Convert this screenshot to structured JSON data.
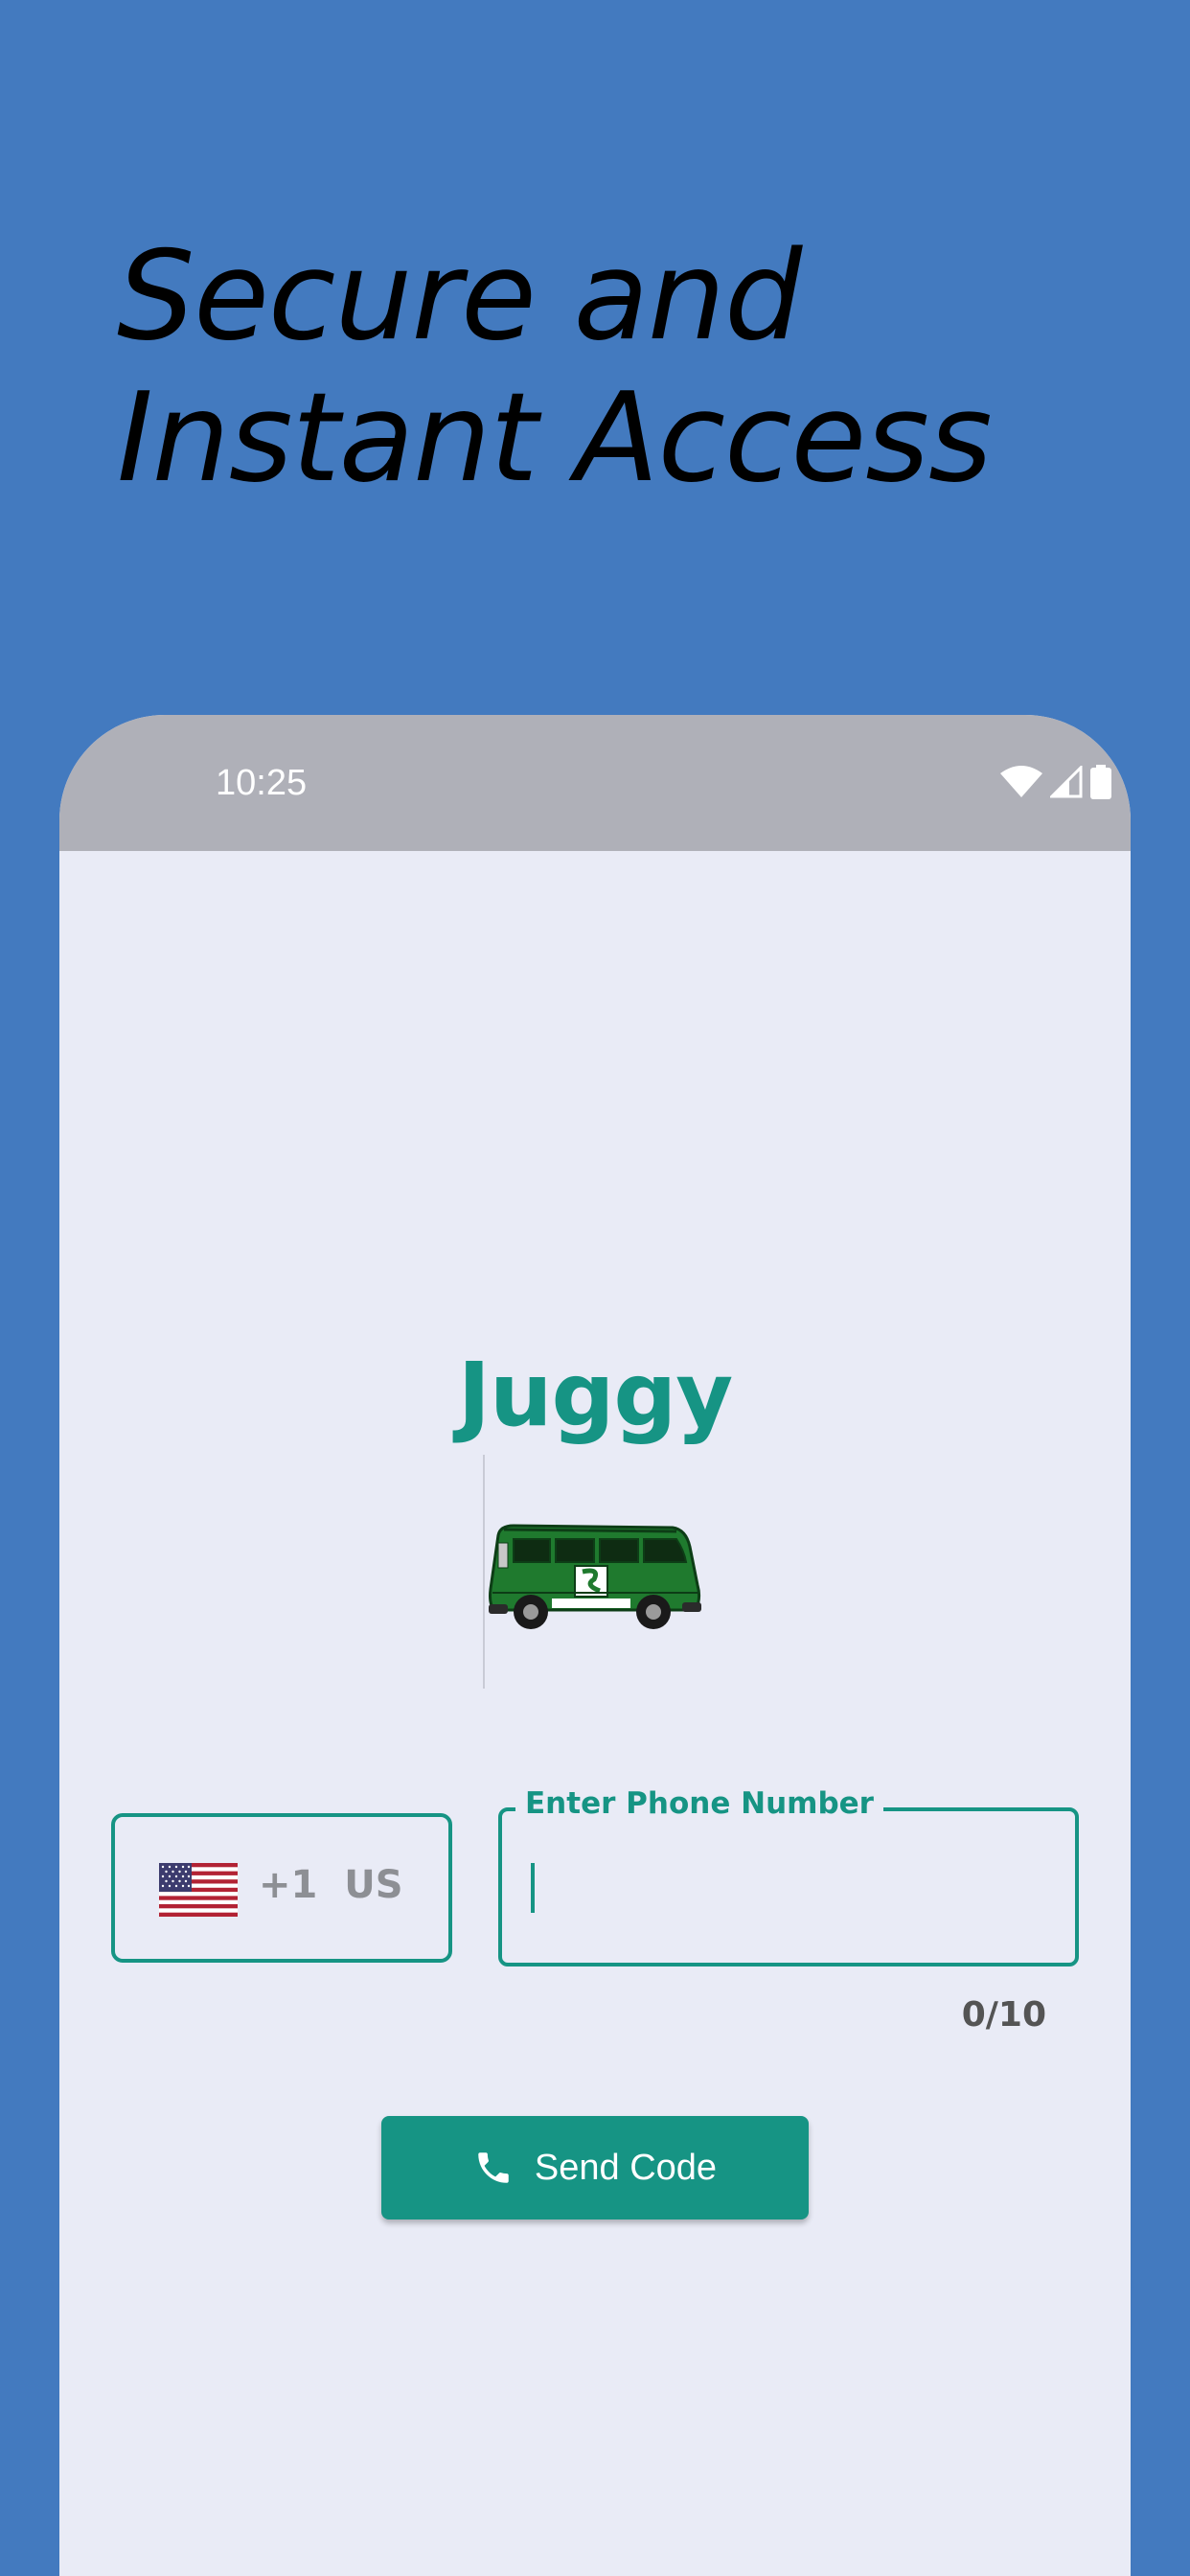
{
  "headline": {
    "line1": "Secure and",
    "line2": "Instant Access"
  },
  "status_bar": {
    "time": "10:25",
    "icons": [
      "wifi-icon",
      "cellular-signal-icon",
      "battery-icon"
    ]
  },
  "app": {
    "title": "Juggy",
    "logo": "van-logo"
  },
  "phone_form": {
    "country": {
      "flag": "us-flag-icon",
      "dial_code": "+1",
      "country_code": "US"
    },
    "phone_field": {
      "label": "Enter Phone Number",
      "value": ""
    },
    "counter": "0/10",
    "send_button": {
      "icon": "phone-icon",
      "label": "Send Code"
    }
  },
  "colors": {
    "background": "#437ABF",
    "accent": "#169484",
    "screen": "#E9EBF6",
    "status_bar": "#AFB0B8"
  }
}
